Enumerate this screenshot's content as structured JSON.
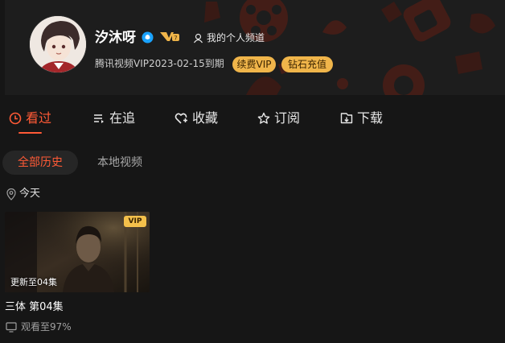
{
  "profile": {
    "username": "汐沐呀",
    "channel_link": "我的个人频道",
    "vip_expire": "腾讯视频VIP2023-02-15到期",
    "renew_label": "续费VIP",
    "topup_label": "钻石充值",
    "vip_level_icon": "vip-level-badge-icon"
  },
  "tabs": [
    {
      "label": "看过",
      "icon": "clock-icon",
      "active": true
    },
    {
      "label": "在追",
      "icon": "list-icon",
      "active": false
    },
    {
      "label": "收藏",
      "icon": "heart-icon",
      "active": false
    },
    {
      "label": "订阅",
      "icon": "star-icon",
      "active": false
    },
    {
      "label": "下载",
      "icon": "download-icon",
      "active": false
    }
  ],
  "filters": {
    "all_history": "全部历史",
    "local_video": "本地视频"
  },
  "history": {
    "date_label": "今天",
    "items": [
      {
        "vip_badge": "VIP",
        "episode_update": "更新至04集",
        "title": "三体 第04集",
        "progress_text": "观看至97%",
        "progress": 0.97
      }
    ]
  },
  "colors": {
    "accent": "#ff5a36",
    "vip_gold": "#f0b54a",
    "background": "#161616"
  }
}
